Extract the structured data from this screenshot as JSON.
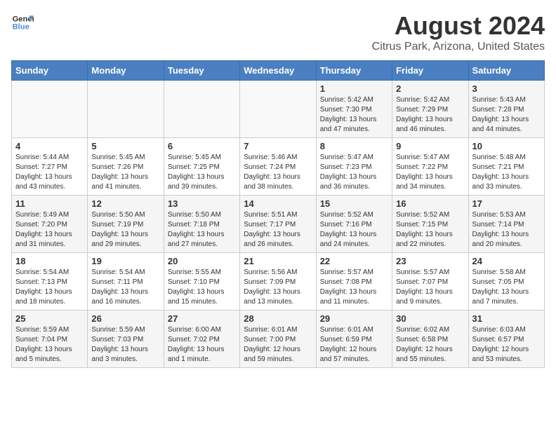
{
  "logo": {
    "line1": "General",
    "line2": "Blue"
  },
  "title": "August 2024",
  "subtitle": "Citrus Park, Arizona, United States",
  "days_of_week": [
    "Sunday",
    "Monday",
    "Tuesday",
    "Wednesday",
    "Thursday",
    "Friday",
    "Saturday"
  ],
  "weeks": [
    [
      {
        "day": "",
        "info": ""
      },
      {
        "day": "",
        "info": ""
      },
      {
        "day": "",
        "info": ""
      },
      {
        "day": "",
        "info": ""
      },
      {
        "day": "1",
        "info": "Sunrise: 5:42 AM\nSunset: 7:30 PM\nDaylight: 13 hours\nand 47 minutes."
      },
      {
        "day": "2",
        "info": "Sunrise: 5:42 AM\nSunset: 7:29 PM\nDaylight: 13 hours\nand 46 minutes."
      },
      {
        "day": "3",
        "info": "Sunrise: 5:43 AM\nSunset: 7:28 PM\nDaylight: 13 hours\nand 44 minutes."
      }
    ],
    [
      {
        "day": "4",
        "info": "Sunrise: 5:44 AM\nSunset: 7:27 PM\nDaylight: 13 hours\nand 43 minutes."
      },
      {
        "day": "5",
        "info": "Sunrise: 5:45 AM\nSunset: 7:26 PM\nDaylight: 13 hours\nand 41 minutes."
      },
      {
        "day": "6",
        "info": "Sunrise: 5:45 AM\nSunset: 7:25 PM\nDaylight: 13 hours\nand 39 minutes."
      },
      {
        "day": "7",
        "info": "Sunrise: 5:46 AM\nSunset: 7:24 PM\nDaylight: 13 hours\nand 38 minutes."
      },
      {
        "day": "8",
        "info": "Sunrise: 5:47 AM\nSunset: 7:23 PM\nDaylight: 13 hours\nand 36 minutes."
      },
      {
        "day": "9",
        "info": "Sunrise: 5:47 AM\nSunset: 7:22 PM\nDaylight: 13 hours\nand 34 minutes."
      },
      {
        "day": "10",
        "info": "Sunrise: 5:48 AM\nSunset: 7:21 PM\nDaylight: 13 hours\nand 33 minutes."
      }
    ],
    [
      {
        "day": "11",
        "info": "Sunrise: 5:49 AM\nSunset: 7:20 PM\nDaylight: 13 hours\nand 31 minutes."
      },
      {
        "day": "12",
        "info": "Sunrise: 5:50 AM\nSunset: 7:19 PM\nDaylight: 13 hours\nand 29 minutes."
      },
      {
        "day": "13",
        "info": "Sunrise: 5:50 AM\nSunset: 7:18 PM\nDaylight: 13 hours\nand 27 minutes."
      },
      {
        "day": "14",
        "info": "Sunrise: 5:51 AM\nSunset: 7:17 PM\nDaylight: 13 hours\nand 26 minutes."
      },
      {
        "day": "15",
        "info": "Sunrise: 5:52 AM\nSunset: 7:16 PM\nDaylight: 13 hours\nand 24 minutes."
      },
      {
        "day": "16",
        "info": "Sunrise: 5:52 AM\nSunset: 7:15 PM\nDaylight: 13 hours\nand 22 minutes."
      },
      {
        "day": "17",
        "info": "Sunrise: 5:53 AM\nSunset: 7:14 PM\nDaylight: 13 hours\nand 20 minutes."
      }
    ],
    [
      {
        "day": "18",
        "info": "Sunrise: 5:54 AM\nSunset: 7:13 PM\nDaylight: 13 hours\nand 18 minutes."
      },
      {
        "day": "19",
        "info": "Sunrise: 5:54 AM\nSunset: 7:11 PM\nDaylight: 13 hours\nand 16 minutes."
      },
      {
        "day": "20",
        "info": "Sunrise: 5:55 AM\nSunset: 7:10 PM\nDaylight: 13 hours\nand 15 minutes."
      },
      {
        "day": "21",
        "info": "Sunrise: 5:56 AM\nSunset: 7:09 PM\nDaylight: 13 hours\nand 13 minutes."
      },
      {
        "day": "22",
        "info": "Sunrise: 5:57 AM\nSunset: 7:08 PM\nDaylight: 13 hours\nand 11 minutes."
      },
      {
        "day": "23",
        "info": "Sunrise: 5:57 AM\nSunset: 7:07 PM\nDaylight: 13 hours\nand 9 minutes."
      },
      {
        "day": "24",
        "info": "Sunrise: 5:58 AM\nSunset: 7:05 PM\nDaylight: 13 hours\nand 7 minutes."
      }
    ],
    [
      {
        "day": "25",
        "info": "Sunrise: 5:59 AM\nSunset: 7:04 PM\nDaylight: 13 hours\nand 5 minutes."
      },
      {
        "day": "26",
        "info": "Sunrise: 5:59 AM\nSunset: 7:03 PM\nDaylight: 13 hours\nand 3 minutes."
      },
      {
        "day": "27",
        "info": "Sunrise: 6:00 AM\nSunset: 7:02 PM\nDaylight: 13 hours\nand 1 minute."
      },
      {
        "day": "28",
        "info": "Sunrise: 6:01 AM\nSunset: 7:00 PM\nDaylight: 12 hours\nand 59 minutes."
      },
      {
        "day": "29",
        "info": "Sunrise: 6:01 AM\nSunset: 6:59 PM\nDaylight: 12 hours\nand 57 minutes."
      },
      {
        "day": "30",
        "info": "Sunrise: 6:02 AM\nSunset: 6:58 PM\nDaylight: 12 hours\nand 55 minutes."
      },
      {
        "day": "31",
        "info": "Sunrise: 6:03 AM\nSunset: 6:57 PM\nDaylight: 12 hours\nand 53 minutes."
      }
    ]
  ]
}
